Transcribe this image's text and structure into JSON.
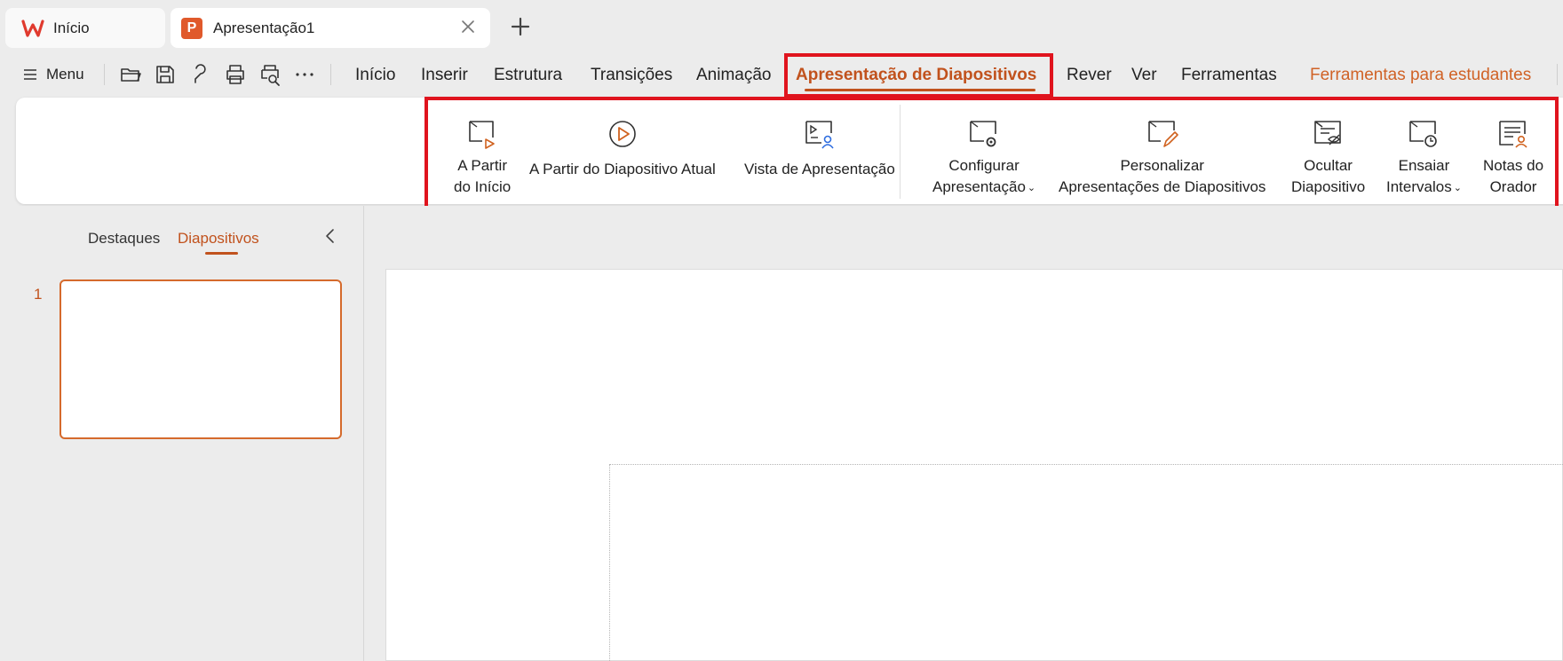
{
  "tabs": {
    "home_label": "Início",
    "doc_label": "Apresentação1",
    "doc_logo_letter": "P"
  },
  "menubar": {
    "menu_label": "Menu",
    "tabs": [
      {
        "label": "Início"
      },
      {
        "label": "Inserir"
      },
      {
        "label": "Estrutura"
      },
      {
        "label": "Transições"
      },
      {
        "label": "Animação"
      },
      {
        "label": "Apresentação de Diapositivos"
      },
      {
        "label": "Rever"
      },
      {
        "label": "Ver"
      },
      {
        "label": "Ferramentas"
      },
      {
        "label": "Ferramentas para estudantes"
      }
    ],
    "active_tab": "Apresentação de Diapositivos"
  },
  "ribbon": {
    "from_start": {
      "line1": "A Partir",
      "line2": "do Início"
    },
    "from_current": "A Partir do Diapositivo Atual",
    "presenter_view": "Vista de Apresentação",
    "setup": {
      "line1": "Configurar",
      "line2": "Apresentação"
    },
    "custom": {
      "line1": "Personalizar",
      "line2": "Apresentações de Diapositivos"
    },
    "hide": {
      "line1": "Ocultar",
      "line2": "Diapositivo"
    },
    "rehearse": {
      "line1": "Ensaiar",
      "line2": "Intervalos"
    },
    "notes": {
      "line1": "Notas do",
      "line2": "Orador"
    }
  },
  "panel": {
    "outline_tab": "Destaques",
    "slides_tab": "Diapositivos",
    "slide_number": "1"
  },
  "colors": {
    "accent": "#c1521d",
    "highlight": "#e0141e",
    "ppt_logo": "#e0592b"
  }
}
